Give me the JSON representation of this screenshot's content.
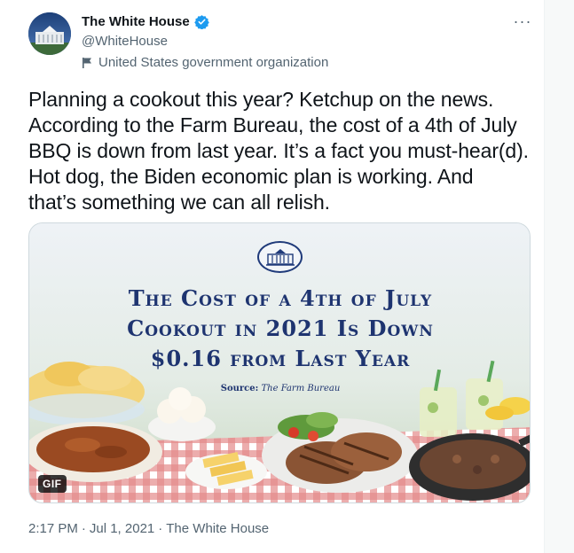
{
  "author": {
    "display_name": "The White House",
    "handle": "@WhiteHouse",
    "label": "United States government organization"
  },
  "menu": {
    "more_label": "···"
  },
  "tweet": {
    "text_lines": [
      "Planning a cookout this year? Ketchup on the news.",
      "According to the Farm Bureau, the cost of a 4th of July",
      "BBQ is down from last year. It’s a fact you must-hear(d).",
      "Hot dog, the Biden economic plan is working. And",
      "that’s something we can all relish."
    ]
  },
  "media": {
    "headline_lines": [
      "The Cost of a 4th of July",
      "Cookout in 2021 Is Down",
      "$0.16 from Last Year"
    ],
    "source_label": "Source:",
    "source_name": "The Farm Bureau",
    "badge": "GIF"
  },
  "meta": {
    "time": "2:17 PM",
    "separator": "·",
    "date": "Jul 1, 2021",
    "source_app": "The White House"
  },
  "colors": {
    "verified": "#1d9bf0",
    "headline": "#1e3470",
    "secondary_text": "#536471"
  },
  "icons": [
    "verified-badge-icon",
    "flag-icon",
    "more-icon",
    "white-house-seal-icon"
  ]
}
